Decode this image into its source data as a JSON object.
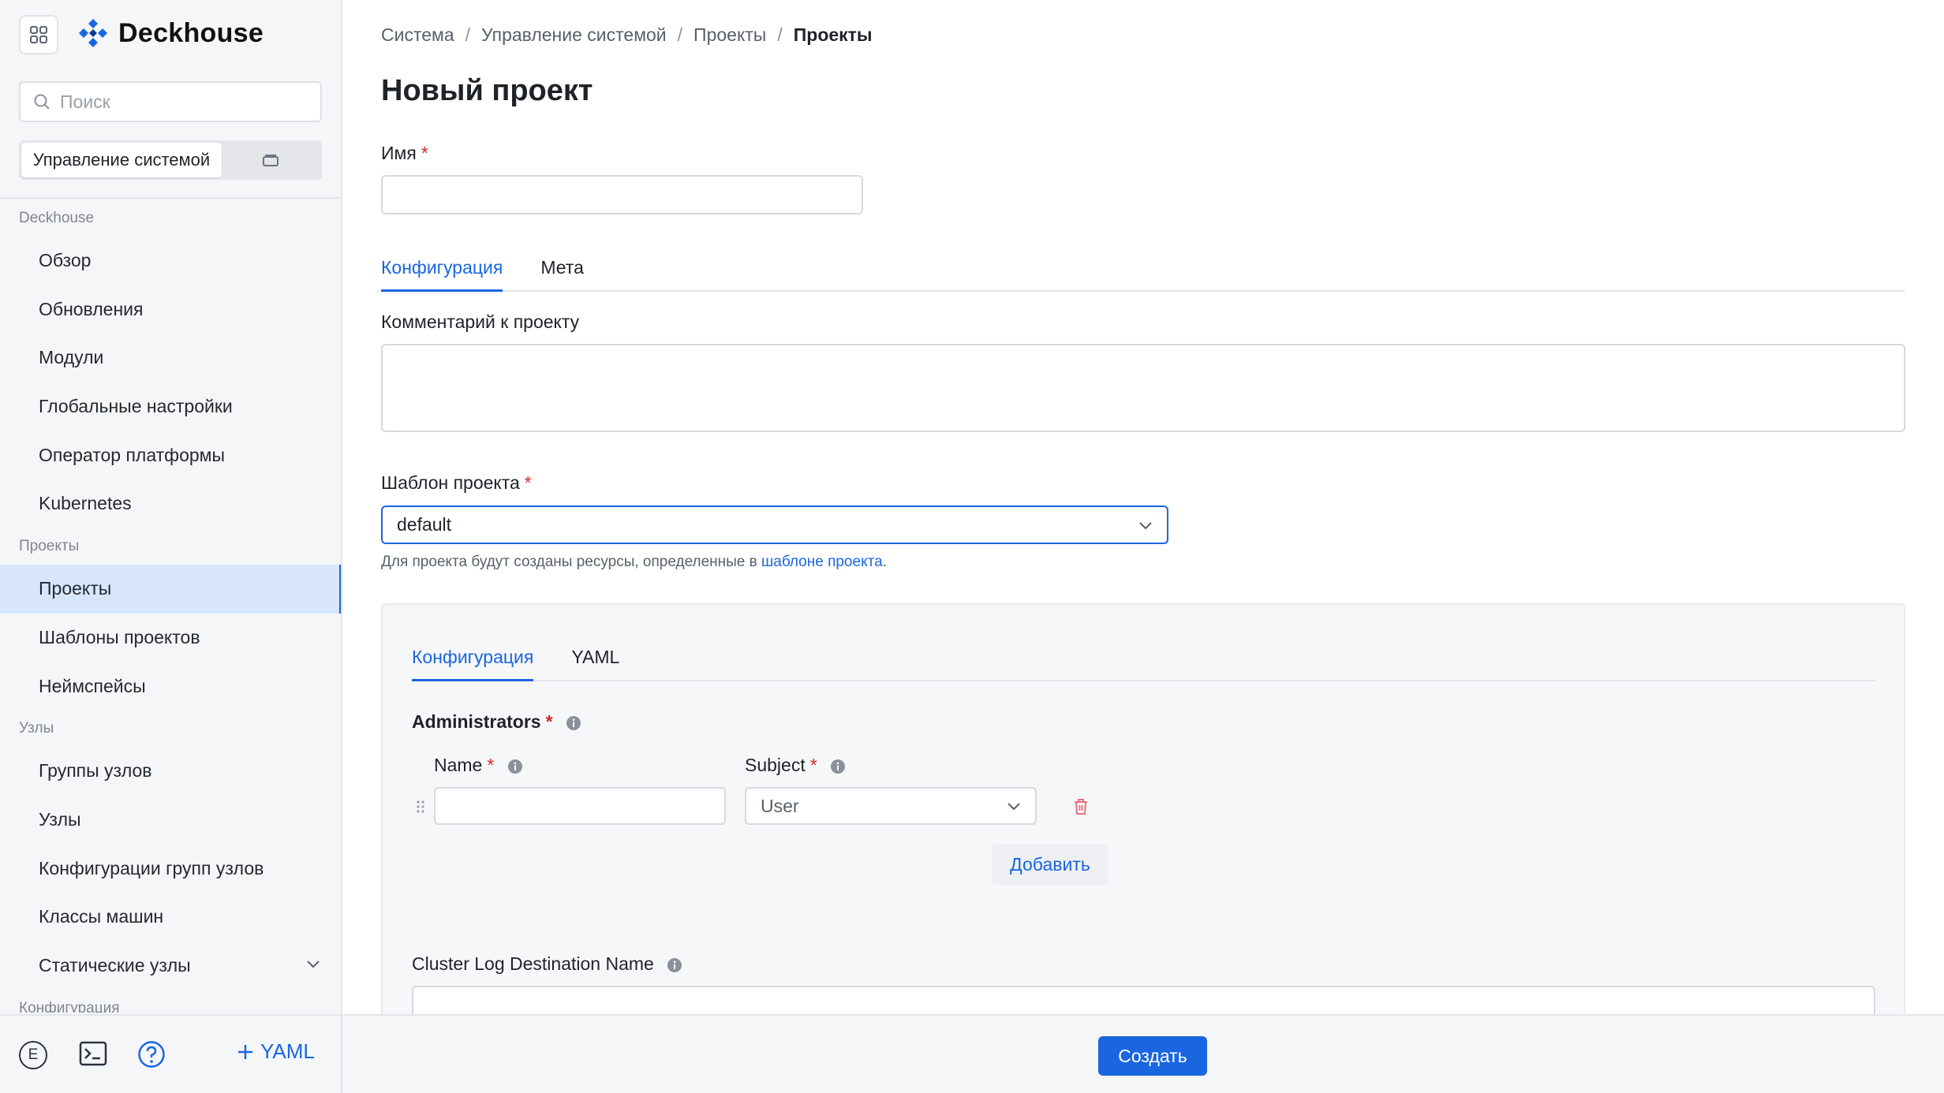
{
  "app": {
    "name": "Deckhouse"
  },
  "sidebar": {
    "search_placeholder": "Поиск",
    "mode_active": "Управление системой",
    "sections": [
      {
        "title": "Deckhouse",
        "items": [
          "Обзор",
          "Обновления",
          "Модули",
          "Глобальные настройки",
          "Оператор платформы",
          "Kubernetes"
        ]
      },
      {
        "title": "Проекты",
        "items": [
          "Проекты",
          "Шаблоны проектов",
          "Неймспейсы"
        ]
      },
      {
        "title": "Узлы",
        "items": [
          "Группы узлов",
          "Узлы",
          "Конфигурации групп узлов",
          "Классы машин",
          "Статические узлы"
        ]
      },
      {
        "title": "Конфигурация",
        "items": []
      }
    ],
    "active_item": "Проекты",
    "avatar_letter": "E",
    "yaml_button": "YAML"
  },
  "breadcrumbs": [
    "Система",
    "Управление системой",
    "Проекты",
    "Проекты"
  ],
  "page_title": "Новый проект",
  "form": {
    "name_label": "Имя",
    "required_mark": "*",
    "name_value": "",
    "tabs": [
      "Конфигурация",
      "Мета"
    ],
    "comment_label": "Комментарий к проекту",
    "comment_value": "",
    "template_label": "Шаблон проекта",
    "template_value": "default",
    "hint_text": "Для проекта будут созданы ресурсы, определенные в ",
    "hint_link": "шаблоне проекта",
    "hint_end": ".",
    "inner_tabs": [
      "Конфигурация",
      "YAML"
    ],
    "administrators_label": "Administrators",
    "admin_name_label": "Name",
    "admin_subject_label": "Subject",
    "admin_name_value": "",
    "admin_subject_value": "User",
    "add_button": "Добавить",
    "cluster_log_label": "Cluster Log Destination Name"
  },
  "footer": {
    "create_button": "Создать"
  },
  "colors": {
    "accent": "#1a66e0",
    "required": "#d42a2a",
    "active_nav_bg": "#d8e6fb",
    "danger_icon": "#e8707a"
  }
}
